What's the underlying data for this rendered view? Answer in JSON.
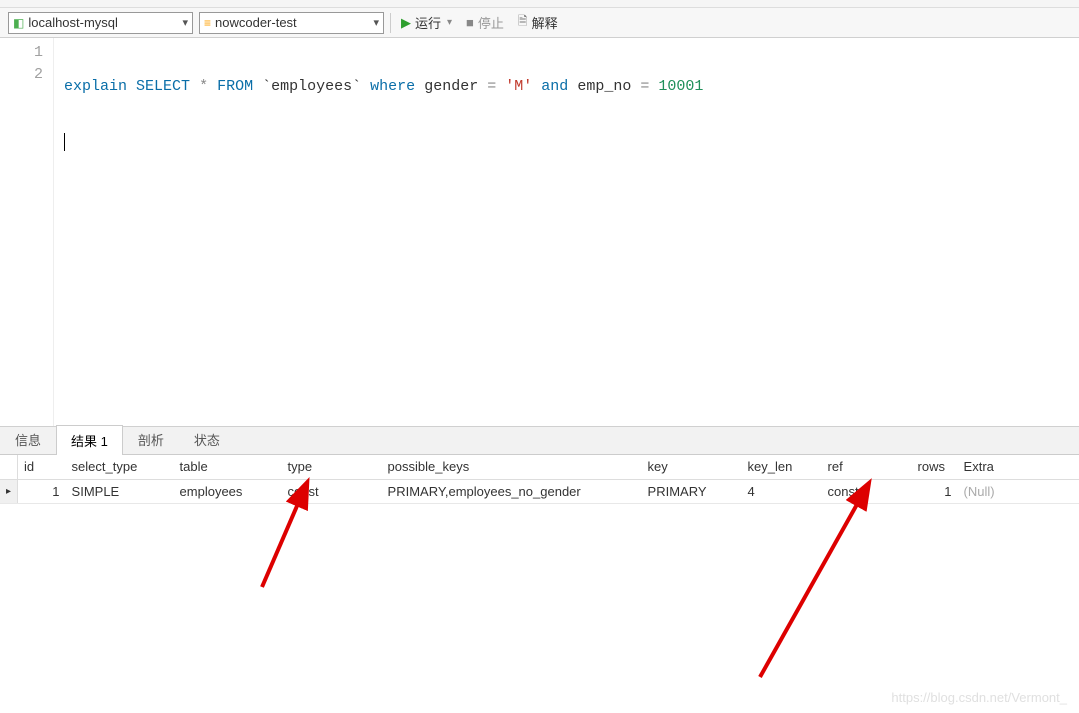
{
  "toolbar": {
    "connection": "localhost-mysql",
    "database": "nowcoder-test",
    "run": "运行",
    "stop": "停止",
    "explain": "解释"
  },
  "editor": {
    "lines": [
      "1",
      "2"
    ],
    "sql": {
      "kw_explain": "explain",
      "kw_select": "SELECT",
      "star": "*",
      "kw_from": "FROM",
      "table": "`employees`",
      "kw_where": "where",
      "col_gender": "gender",
      "eq1": "=",
      "str_m": "'M'",
      "kw_and": "and",
      "col_emp_no": "emp_no",
      "eq2": "=",
      "num_10001": "10001"
    }
  },
  "tabs": {
    "info": "信息",
    "result": "结果 1",
    "profile": "剖析",
    "status": "状态"
  },
  "grid": {
    "headers": {
      "id": "id",
      "select_type": "select_type",
      "table": "table",
      "type": "type",
      "possible_keys": "possible_keys",
      "key": "key",
      "key_len": "key_len",
      "ref": "ref",
      "rows": "rows",
      "extra": "Extra"
    },
    "row": {
      "marker": "▸",
      "id": "1",
      "select_type": "SIMPLE",
      "table": "employees",
      "type": "const",
      "possible_keys": "PRIMARY,employees_no_gender",
      "key": "PRIMARY",
      "key_len": "4",
      "ref": "const",
      "rows": "1",
      "extra": "(Null)"
    }
  },
  "watermark": "https://blog.csdn.net/Vermont_"
}
